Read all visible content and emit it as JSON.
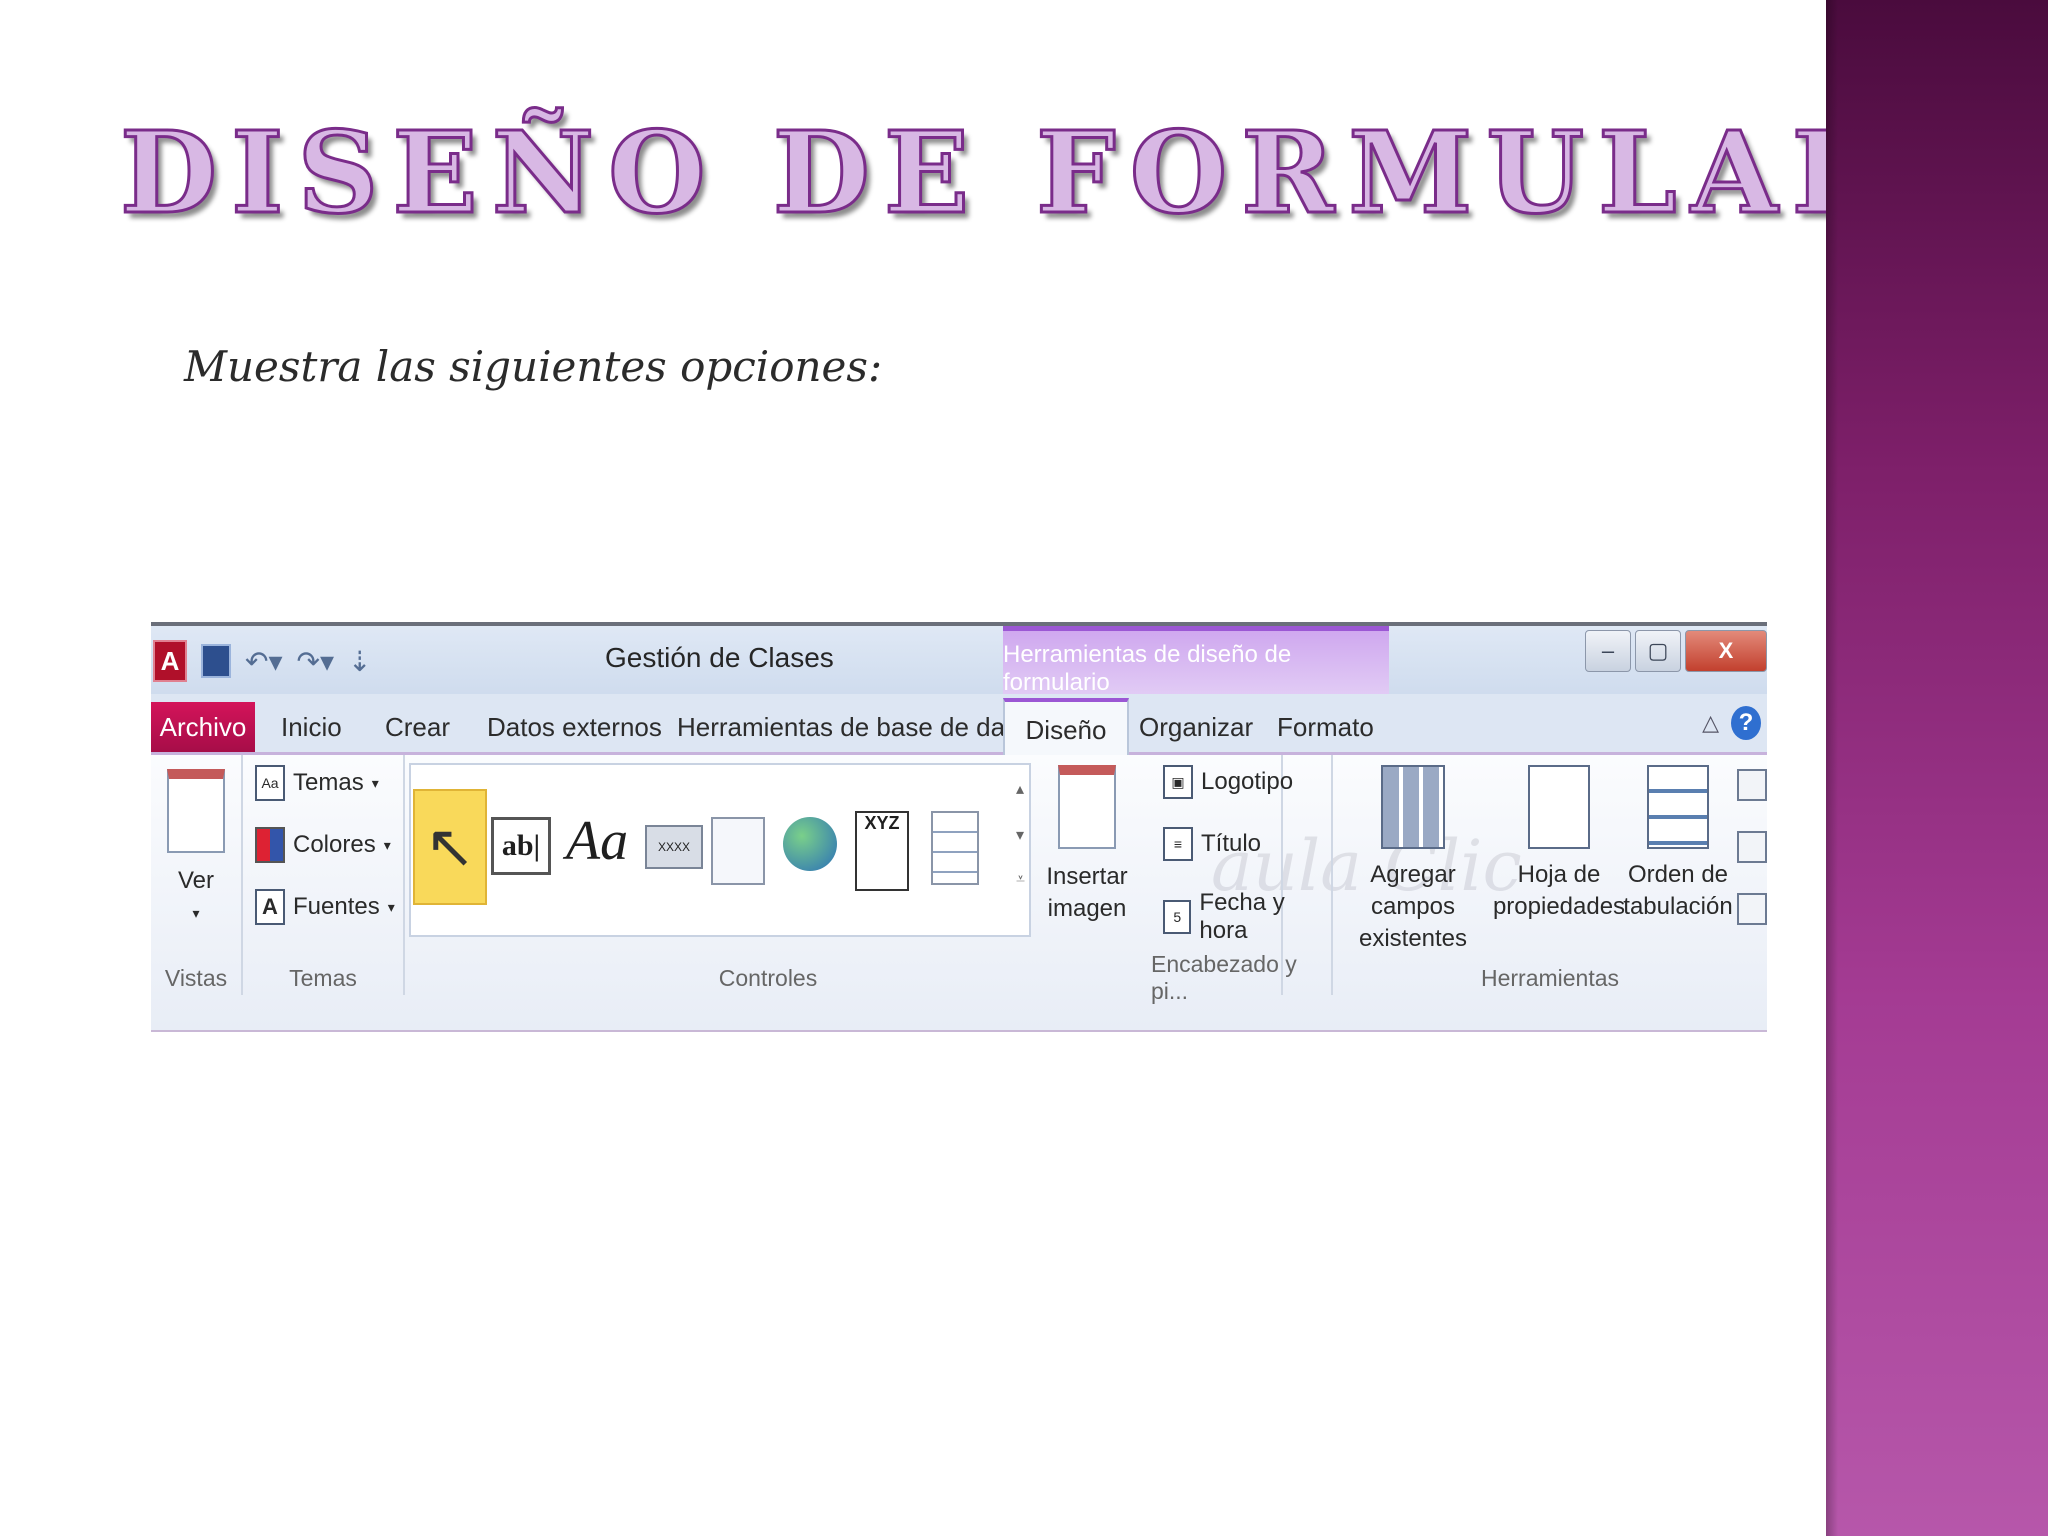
{
  "slide": {
    "title": "DISEÑO DE FORMULARIO",
    "subtitle": "Muestra las siguientes opciones:"
  },
  "ribbon": {
    "app_title": "Gestión de Clases",
    "context_title": "Herramientas de diseño de formulario",
    "window_controls": {
      "minimize": "–",
      "restore": "▢",
      "close": "X"
    },
    "tabs": [
      "Archivo",
      "Inicio",
      "Crear",
      "Datos externos",
      "Herramientas de base de datos",
      "Diseño",
      "Organizar",
      "Formato"
    ],
    "active_tab": "Diseño",
    "help": "?",
    "groups": {
      "vistas": {
        "label": "Vistas",
        "ver": "Ver"
      },
      "temas": {
        "label": "Temas",
        "temas": "Temas",
        "colores": "Colores",
        "fuentes": "Fuentes"
      },
      "controles": {
        "label": "Controles",
        "label_ctl": "Aa",
        "text_ctl": "ab|",
        "button_ctl": "XXXX",
        "title_ctl": "XYZ"
      },
      "insertar": {
        "line1": "Insertar",
        "line2": "imagen"
      },
      "encabezado": {
        "label": "Encabezado y pi...",
        "logotipo": "Logotipo",
        "titulo": "Título",
        "fecha": "Fecha y hora"
      },
      "herramientas": {
        "label": "Herramientas",
        "agregar_1": "Agregar campos",
        "agregar_2": "existentes",
        "hoja_1": "Hoja de",
        "hoja_2": "propiedades",
        "orden_1": "Orden de",
        "orden_2": "tabulación"
      }
    },
    "watermark": "aula Clic"
  }
}
